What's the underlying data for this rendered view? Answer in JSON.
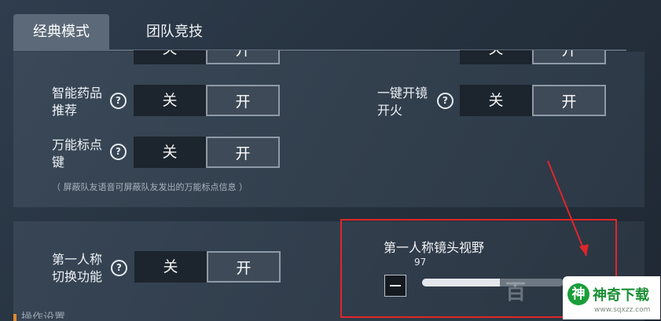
{
  "tabs": [
    {
      "label": "经典模式"
    },
    {
      "label": "团队竞技"
    }
  ],
  "toggle": {
    "off_label": "关",
    "on_label": "开"
  },
  "settings": {
    "smart_medicine": {
      "line1": "智能药品",
      "line2": "推荐"
    },
    "one_tap_scope_fire": {
      "line1": "一键开镜",
      "line2": "开火"
    },
    "universal_marker": {
      "line1": "万能标点",
      "line2": "键"
    },
    "universal_marker_hint": "（ 屏蔽队友语音可屏蔽队友发出的万能标点信息 ）",
    "first_person_switch": {
      "line1": "第一人称",
      "line2": "切换功能"
    }
  },
  "fov": {
    "title": "第一人称镜头视野",
    "value": "97",
    "level_fraction": 0.55,
    "minus_icon": "minus-icon"
  },
  "bottom_section": {
    "label": "操作设置"
  },
  "help_icon": "?",
  "watermark": {
    "text": "百"
  },
  "brand": {
    "logo": "神",
    "name": "神奇下载",
    "url": "www.sqxzz.com"
  },
  "colors": {
    "highlight_box": "#e0262a",
    "arrow": "#e0262a",
    "brand_green": "#1a9e3a"
  }
}
